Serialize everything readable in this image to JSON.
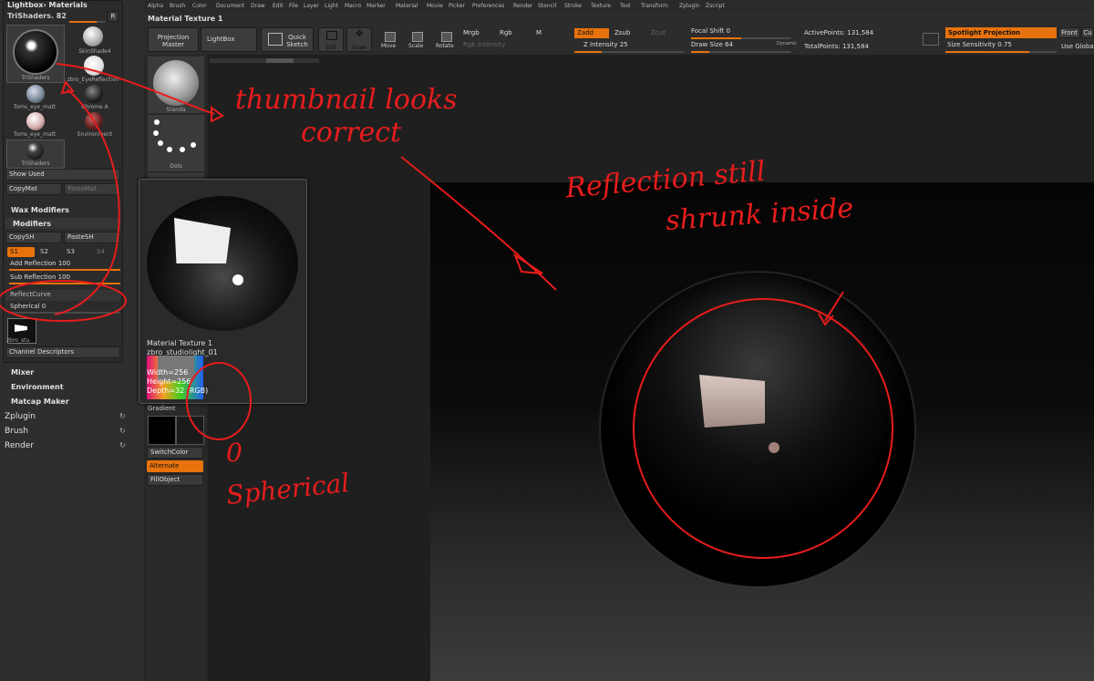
{
  "menu": [
    "Alpha",
    "Brush",
    "Color",
    "Document",
    "Draw",
    "Edit",
    "File",
    "Layer",
    "Light",
    "Macro",
    "Marker",
    "Material",
    "Movie",
    "Picker",
    "Preferences",
    "Render",
    "Stencil",
    "Stroke",
    "Texture",
    "Tool",
    "Transform",
    "Zplugin",
    "Zscript"
  ],
  "doc_title": "Material Texture 1",
  "toolbar": {
    "projection_master": "Projection Master",
    "lightbox": "LightBox",
    "quick_sketch": "Quick Sketch",
    "edit": "Edit",
    "draw": "Draw",
    "move": "Move",
    "scale": "Scale",
    "rotate": "Rotate",
    "mrgb": "Mrgb",
    "rgb": "Rgb",
    "m": "M",
    "rgb_intensity": "Rgb Intensity",
    "zadd": "Zadd",
    "zsub": "Zsub",
    "zcut": "Zcut",
    "z_intensity": "Z Intensity 25",
    "focal_shift": "Focal Shift 0",
    "draw_size": "Draw Size 64",
    "dynamic": "Dynamic",
    "active_points": "ActivePoints: 131,584",
    "total_points": "TotalPoints: 131,584",
    "spotlight_projection": "Spotlight Projection",
    "size_sensitivity": "Size Sensitivity 0.75",
    "front": "Front",
    "use_global": "Use Globa",
    "cu": "Cu"
  },
  "left": {
    "panel_title": "Lightbox› Materials",
    "current_material": "TriShaders. 82",
    "r_button": "R",
    "thumbs": [
      {
        "label": "TriShaders"
      },
      {
        "label": "SkinShade4"
      },
      {
        "label": "zbro_EyeReflection"
      },
      {
        "label": "Toms_eye_matt"
      },
      {
        "label": "Chrome A"
      },
      {
        "label": "Toms_eye_matt"
      },
      {
        "label": "Environment"
      },
      {
        "label": "TriShaders"
      }
    ],
    "show_used": "Show Used",
    "copy_mat": "CopyMat",
    "paste_mat": "PasteMat",
    "wax_modifiers": "Wax Modifiers",
    "modifiers": "Modifiers",
    "copy_sh": "CopySH",
    "paste_sh": "PasteSH",
    "s1": "S1",
    "s2": "S2",
    "s3": "S3",
    "s4": "S4",
    "add_reflection": "Add Reflection 100",
    "sub_reflection": "Sub Reflection 100",
    "reflect_curve": "ReflectCurve",
    "spherical": "Spherical 0",
    "texture_thumb_label": "zbro_stu",
    "channel_descriptors": "Channel Descriptors",
    "mixer": "Mixer",
    "environment": "Environment",
    "matcap_maker": "Matcap Maker",
    "zplugin": "Zplugin",
    "brush": "Brush",
    "render": "Render"
  },
  "shelf": {
    "standard": "Standa",
    "dots": "Dots",
    "gradient": "Gradient",
    "switch_color": "SwitchColor",
    "alternate": "Alternate",
    "fill_object": "FillObject"
  },
  "popup": {
    "title": "Material Texture 1",
    "name": "zbro_studiolight_01",
    "width": "Width=256",
    "height": "Height=256",
    "depth": "Depth=32 (RGB)"
  },
  "annotations": {
    "thumb": "thumbnail looks",
    "thumb2": "correct",
    "refl": "Reflection still",
    "refl2": "shrunk inside",
    "zero": "0",
    "sph": "Spherical"
  },
  "colors": {
    "accent": "#e8720c",
    "annotation": "#e81c1c"
  }
}
